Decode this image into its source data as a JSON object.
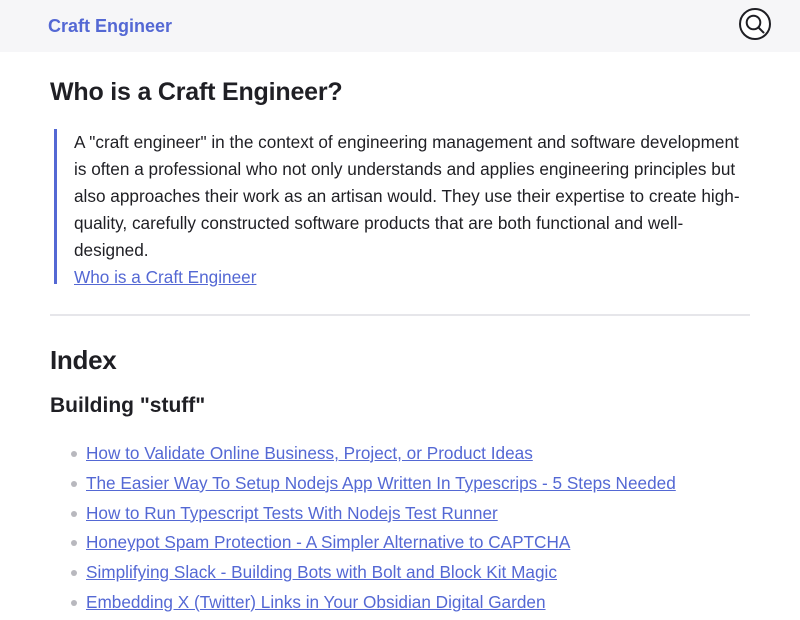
{
  "header": {
    "site_title": "Craft Engineer",
    "search_icon": "search-icon",
    "accent_color": "#5468d4"
  },
  "page": {
    "title": "Who is a Craft Engineer?",
    "quote_text": "A \"craft engineer\" in the context of engineering management and software development is often a professional who not only understands and applies engineering principles but also approaches their work as an artisan would. They use their expertise to create high-quality, carefully constructed software products that are both functional and well-designed.",
    "quote_link": "Who is a Craft Engineer"
  },
  "index": {
    "heading": "Index",
    "section_heading": "Building \"stuff\"",
    "items": [
      {
        "label": "How to Validate Online Business, Project, or Product Ideas"
      },
      {
        "label": "The Easier Way To Setup Nodejs App Written In Typescrips - 5 Steps Needed"
      },
      {
        "label": "How to Run Typescript Tests With Nodejs Test Runner"
      },
      {
        "label": "Honeypot Spam Protection - A Simpler Alternative to CAPTCHA"
      },
      {
        "label": "Simplifying Slack - Building Bots with Bolt and Block Kit Magic"
      },
      {
        "label": "Embedding X (Twitter) Links in Your Obsidian Digital Garden"
      }
    ]
  }
}
